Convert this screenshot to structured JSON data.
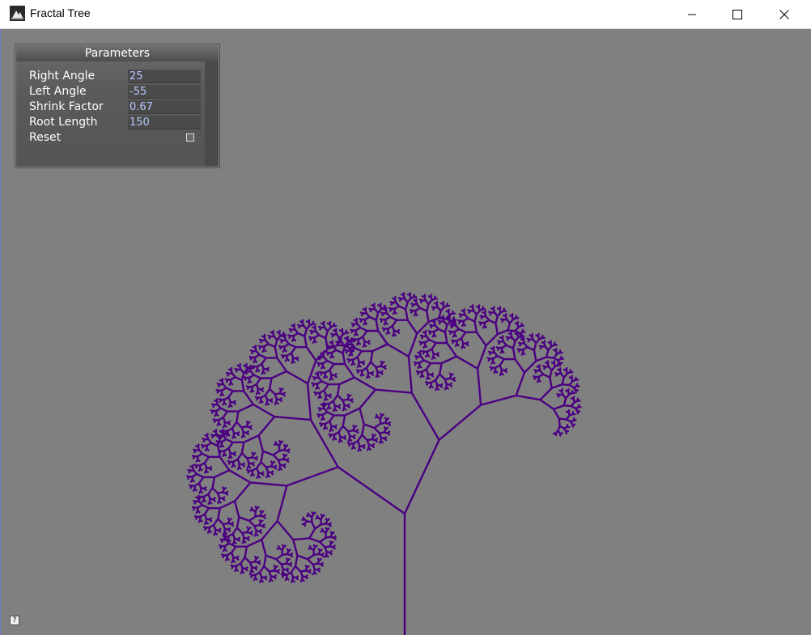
{
  "window": {
    "title": "Fractal Tree",
    "icon": "app-icon"
  },
  "panel": {
    "title": "Parameters",
    "params": [
      {
        "label": "Right Angle",
        "value": "25"
      },
      {
        "label": "Left Angle",
        "value": "-55"
      },
      {
        "label": "Shrink Factor",
        "value": "0.67"
      },
      {
        "label": "Root Length",
        "value": "150"
      }
    ],
    "reset_label": "Reset"
  },
  "help": {
    "label": "?"
  },
  "colors": {
    "background": "#808080",
    "tree": "#4b0082",
    "param_value_text": "#b4c8ff"
  }
}
